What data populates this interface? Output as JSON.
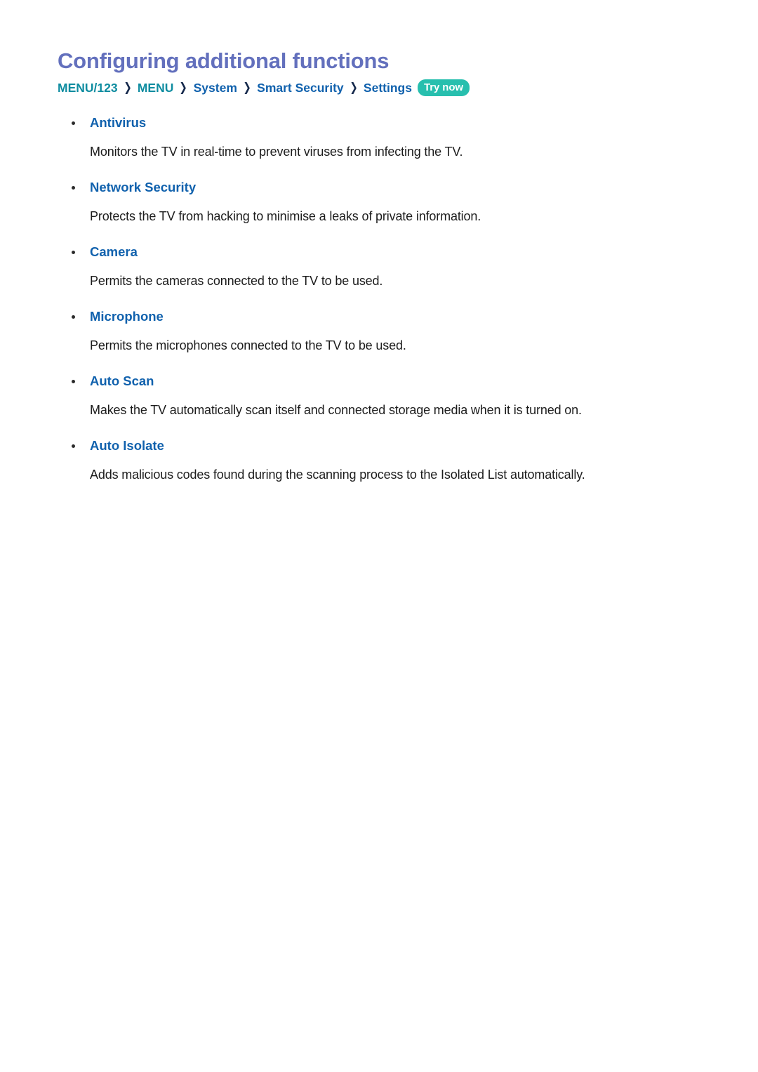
{
  "document": {
    "title": "Configuring additional functions",
    "title_color": "#6370bd",
    "background_color": "#ffffff",
    "body_text_color": "#1c1c1c"
  },
  "breadcrumb": {
    "separator": "❯",
    "separator_color": "#14284b",
    "teal_color": "#0e8ca0",
    "blue_color": "#1061ad",
    "crumbs": [
      {
        "label": "MENU/123",
        "color": "teal"
      },
      {
        "label": "MENU",
        "color": "teal"
      },
      {
        "label": "System",
        "color": "blue"
      },
      {
        "label": "Smart Security",
        "color": "blue"
      },
      {
        "label": "Settings",
        "color": "blue"
      }
    ],
    "badge": {
      "label": "Try now",
      "background_color": "#27bfae",
      "text_color": "#ffffff"
    }
  },
  "functions": [
    {
      "name": "Antivirus",
      "description": "Monitors the TV in real-time to prevent viruses from infecting the TV."
    },
    {
      "name": "Network Security",
      "description": "Protects the TV from hacking to minimise a leaks of private information."
    },
    {
      "name": "Camera",
      "description": "Permits the cameras connected to the TV to be used."
    },
    {
      "name": "Microphone",
      "description": "Permits the microphones connected to the TV to be used."
    },
    {
      "name": "Auto Scan",
      "description": "Makes the TV automatically scan itself and connected storage media when it is turned on."
    },
    {
      "name": "Auto Isolate",
      "description": "Adds malicious codes found during the scanning process to the Isolated List automatically."
    }
  ]
}
